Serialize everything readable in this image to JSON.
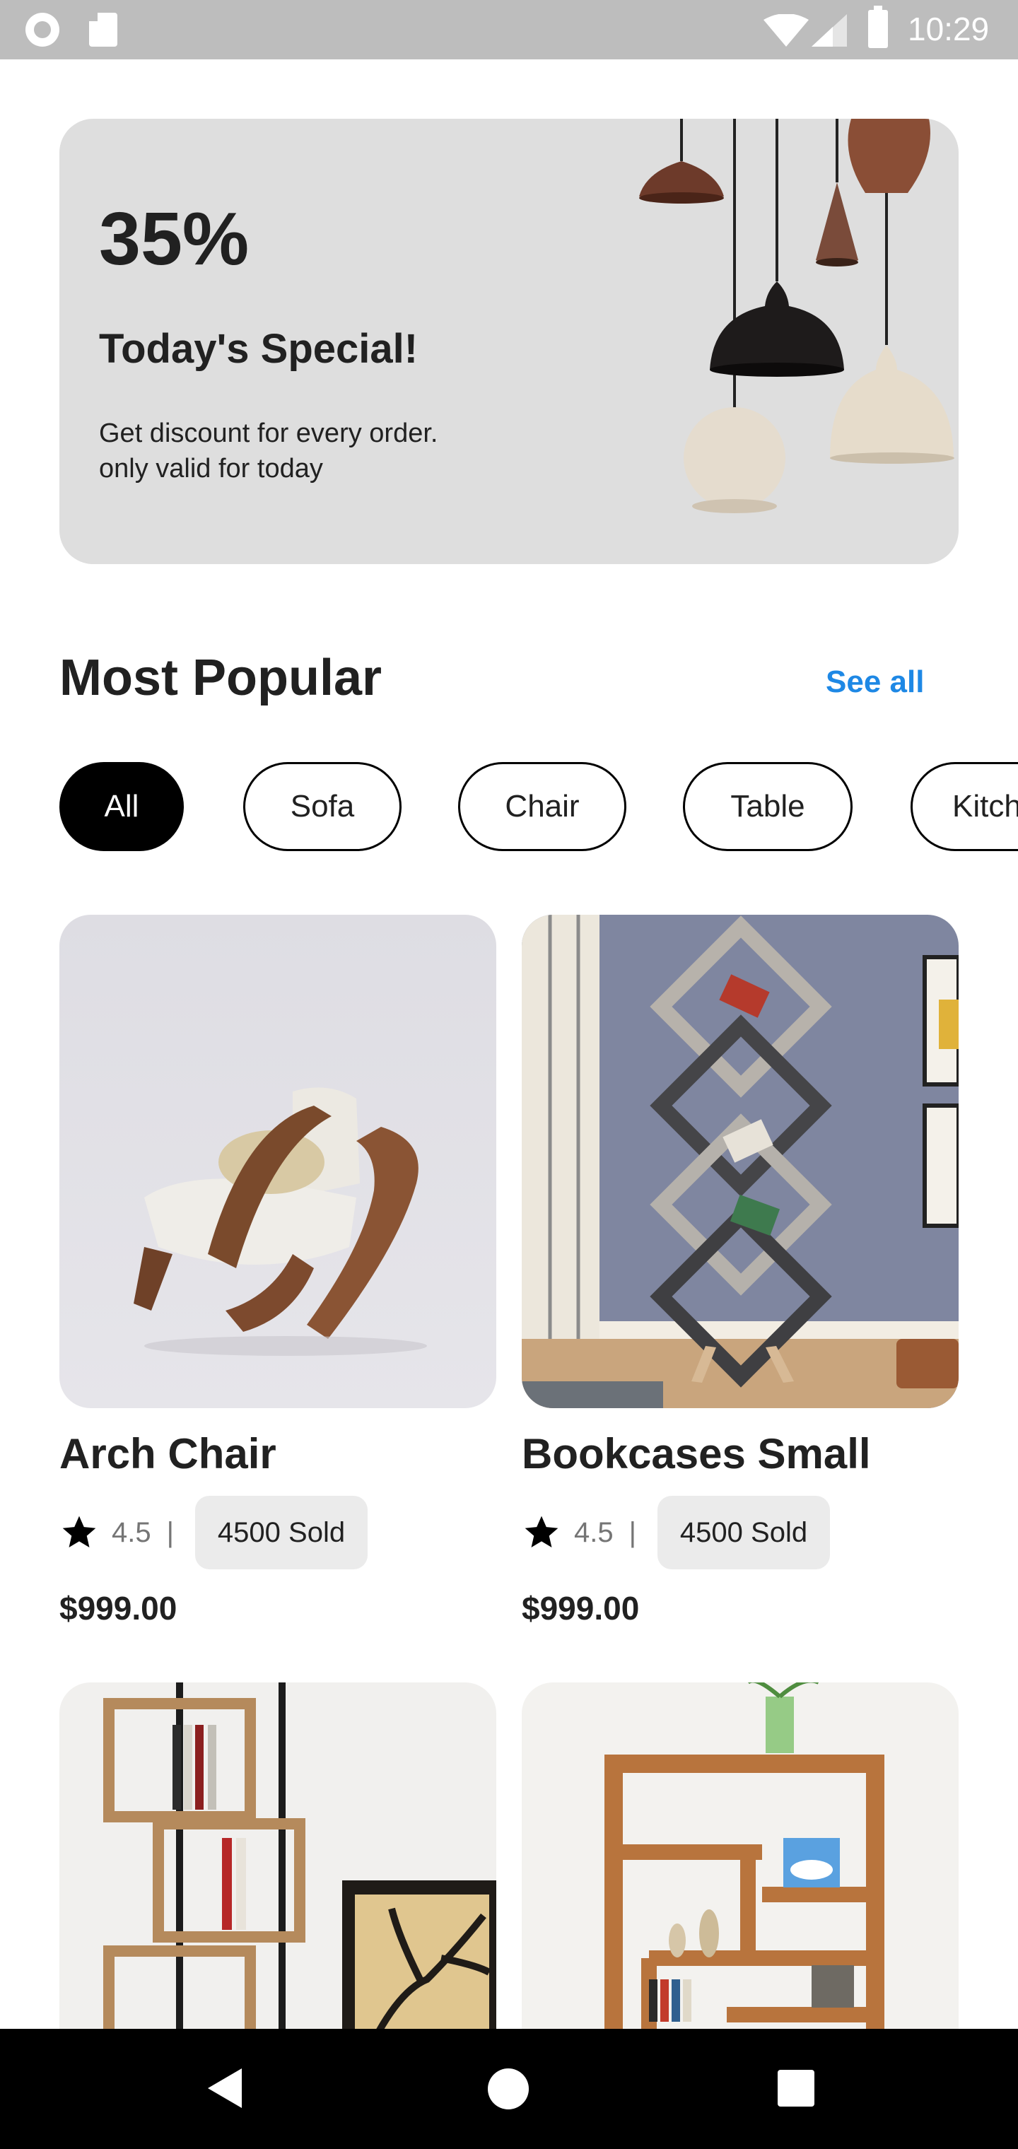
{
  "status_bar": {
    "time": "10:29"
  },
  "promo": {
    "discount": "35%",
    "title": "Today's Special!",
    "description": "Get discount for every order. only valid for today"
  },
  "section": {
    "title": "Most Popular",
    "see_all": "See all"
  },
  "categories": [
    {
      "label": "All",
      "active": true
    },
    {
      "label": "Sofa",
      "active": false
    },
    {
      "label": "Chair",
      "active": false
    },
    {
      "label": "Table",
      "active": false
    },
    {
      "label": "Kitchen",
      "active": false
    }
  ],
  "products": [
    {
      "name": "Arch Chair",
      "rating": "4.5",
      "separator": "|",
      "sold": "4500 Sold",
      "price": "$999.00"
    },
    {
      "name": "Bookcases Small",
      "rating": "4.5",
      "separator": "|",
      "sold": "4500 Sold",
      "price": "$999.00"
    }
  ],
  "colors": {
    "accent": "#1e88e5",
    "promo_bg": "#dedede",
    "chip_active": "#000000"
  },
  "icons": [
    "star-icon",
    "back-icon",
    "home-icon",
    "recents-icon",
    "wifi-icon",
    "signal-icon",
    "battery-icon"
  ]
}
